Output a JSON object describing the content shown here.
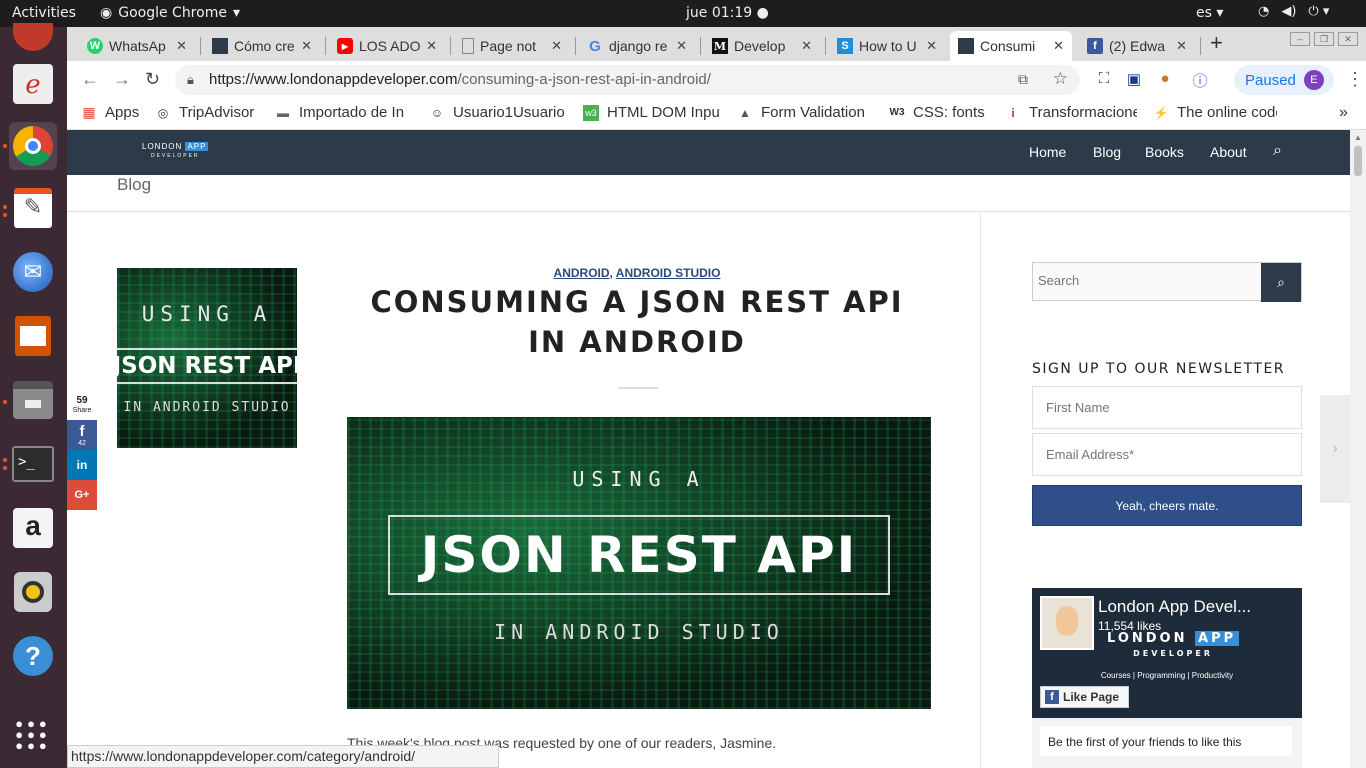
{
  "topbar": {
    "activities": "Activities",
    "app": "Google Chrome",
    "clock": "jue 01:19",
    "lang": "es"
  },
  "dock": [
    "help-app",
    "mail",
    "chrome",
    "text-editor",
    "thunderbird",
    "impress",
    "files",
    "terminal",
    "amazon",
    "rhythmbox",
    "help",
    "app-grid"
  ],
  "tabs": [
    {
      "title": "WhatsAp",
      "fav": "W",
      "color": "#25d366"
    },
    {
      "title": "Cómo cre",
      "fav": "",
      "color": "#2d3a4a"
    },
    {
      "title": "LOS ADO",
      "fav": "▶",
      "color": "#ff0000"
    },
    {
      "title": "Page not",
      "fav": "",
      "color": "#888"
    },
    {
      "title": "django re",
      "fav": "G",
      "color": "#4285f4"
    },
    {
      "title": "Develop",
      "fav": "M",
      "color": "#111"
    },
    {
      "title": "How to U",
      "fav": "S",
      "color": "#1e8fd6"
    },
    {
      "title": "Consumi",
      "fav": "",
      "color": "#2d3a4a"
    },
    {
      "title": "(2) Edwa",
      "fav": "f",
      "color": "#3b5998"
    }
  ],
  "toolbar": {
    "url_domain": "https://www.londonappdeveloper.com",
    "url_path": "/consuming-a-json-rest-api-in-android/",
    "paused_label": "Paused",
    "avatar_initial": "E"
  },
  "bookmarks": [
    {
      "label": "Apps",
      "icon": "▦"
    },
    {
      "label": "TripAdvisor",
      "icon": "◎"
    },
    {
      "label": "Importado de In",
      "icon": "▬"
    },
    {
      "label": "Usuario1Usuario",
      "icon": "☺"
    },
    {
      "label": "HTML DOM Inpu",
      "icon": "w3"
    },
    {
      "label": "Form Validation",
      "icon": "▲"
    },
    {
      "label": "CSS: fonts",
      "icon": "W3"
    },
    {
      "label": "Transformacione",
      "icon": "i"
    },
    {
      "label": "The online code",
      "icon": "⚡"
    }
  ],
  "site": {
    "logo_top": "LONDON",
    "logo_app": "APP",
    "logo_bottom": "DEVELOPER",
    "nav": [
      "Home",
      "Blog",
      "Books",
      "About"
    ],
    "breadcrumb": "Blog"
  },
  "post": {
    "cat1": "ANDROID",
    "cat_sep": ",",
    "cat2": "ANDROID STUDIO",
    "title": "CONSUMING A JSON REST API IN ANDROID",
    "image_line1": "USING A",
    "image_line2": "JSON REST API",
    "image_line3": "IN ANDROID STUDIO",
    "intro": "This week's blog post was requested by one of our readers, Jasmine."
  },
  "share": {
    "count": "59",
    "count_label": "Share",
    "facebook_count": "42",
    "facebook": "f",
    "linkedin": "in",
    "googleplus": "G+"
  },
  "sidebar": {
    "search_placeholder": "Search",
    "newsletter_title": "SIGN UP TO OUR NEWSLETTER",
    "first_name_placeholder": "First Name",
    "email_placeholder": "Email Address*",
    "submit_label": "Yeah, cheers mate.",
    "fb_name": "London App Devel...",
    "fb_likes": "11,554 likes",
    "fb_logo_top": "LONDON",
    "fb_logo_app": "APP",
    "fb_logo_bottom": "DEVELOPER",
    "fb_tagline": "Courses | Programming | Productivity",
    "fb_like_btn": "Like Page",
    "fb_first": "Be the first of your friends to like this"
  },
  "status_url": "https://www.londonappdeveloper.com/category/android/"
}
